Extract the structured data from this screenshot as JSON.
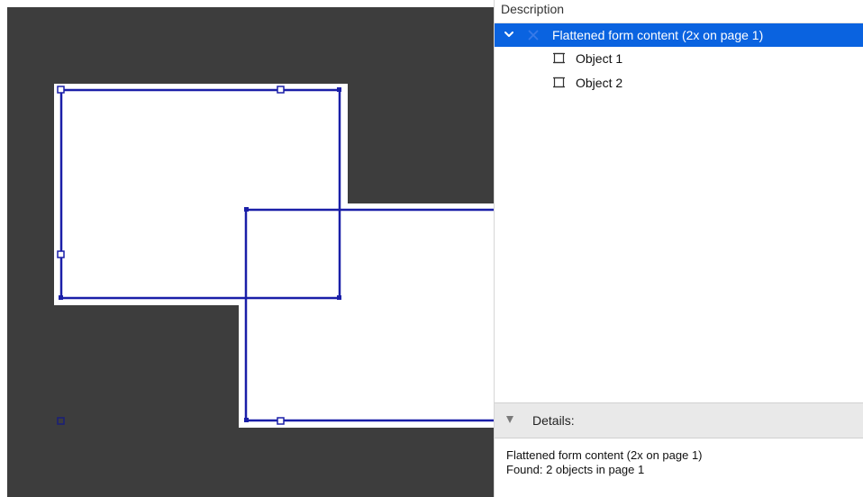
{
  "colors": {
    "canvas_bg": "#3d3d3d",
    "page_fill": "#ffffff",
    "object_stroke": "#1a1fa8",
    "selection_bg": "#0a63e0"
  },
  "panel": {
    "column_header": "Description",
    "tree": {
      "root": {
        "label": "Flattened form content (2x on page 1)",
        "expanded": true,
        "icon": "flatten-icon",
        "children": [
          {
            "label": "Object 1",
            "icon": "object-icon"
          },
          {
            "label": "Object 2",
            "icon": "object-icon"
          }
        ]
      }
    },
    "details": {
      "label": "Details:",
      "lines": [
        "Flattened form content (2x on page 1)",
        "Found: 2 objects in page 1"
      ]
    }
  }
}
